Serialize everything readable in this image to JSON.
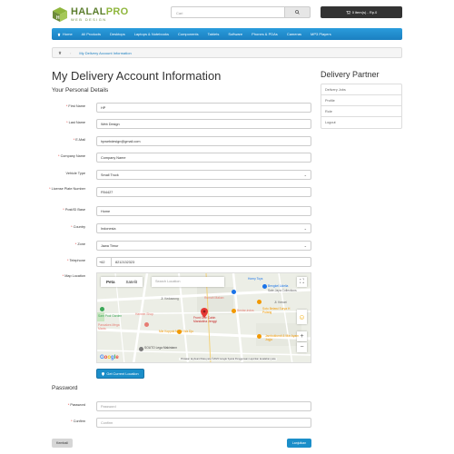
{
  "header": {
    "logo_main": "HALAL",
    "logo_pro": "PRO",
    "logo_sub": "WEB DESIGN",
    "search_placeholder": "Cari",
    "cart_label": "0 item(s) - Rp.0"
  },
  "menu": {
    "items": [
      "Home",
      "All Products",
      "Desktops",
      "Laptops & Notebooks",
      "Components",
      "Tablets",
      "Software",
      "Phones & PDAs",
      "Cameras",
      "MP3 Players"
    ]
  },
  "breadcrumb": {
    "current": "My Delivery Account Information"
  },
  "page": {
    "title": "My Delivery Account Information",
    "personal_heading": "Your Personal Details",
    "password_heading": "Password"
  },
  "form": {
    "first_name": {
      "label": "First Name",
      "value": "HP"
    },
    "last_name": {
      "label": "Last Name",
      "value": "Web Design"
    },
    "email": {
      "label": "E-Mail",
      "value": "hpwebdesign@gmail.com"
    },
    "company": {
      "label": "Company Name",
      "value": "Company Name"
    },
    "vehicle": {
      "label": "Vehicle Type",
      "value": "Small Truck"
    },
    "license": {
      "label": "License Plate Number",
      "value": "FB4427"
    },
    "post_base": {
      "label": "Post/ID Base",
      "value": "Home"
    },
    "country": {
      "label": "Country",
      "value": "Indonesia"
    },
    "zone": {
      "label": "Zone",
      "value": "Jawa Timur"
    },
    "telephone": {
      "label": "Telephone",
      "code": "+62",
      "value": "8212132323"
    },
    "map_location": {
      "label": "Map Location"
    },
    "password": {
      "label": "Password",
      "placeholder": "Password"
    },
    "confirm": {
      "label": "Confirm",
      "placeholder": "Confirm"
    }
  },
  "map": {
    "tab_map": "Peta",
    "tab_sat": "Satelit",
    "search_placeholder": "Search Location",
    "labels": {
      "l1": "Horny Toys",
      "l2": "Bengkel Lidelia",
      "l3": "Sale-Jaya Collections",
      "l4": "Jl. Kedawung",
      "l5": "Rumah Makan",
      "l6": "Bentar-indos",
      "l7": "Sam Pool Garden",
      "l8": "Harwee Shop",
      "l9": "Front One Cabin Mandalina Jenggi",
      "l10": "Soto Betawi Surya H Pulang",
      "l11": "Pancakes Mega Manis",
      "l12": "Mie Kopyok Mbah Wa Djo",
      "l13": "Jambuklundi & Mie Ayam Jogja",
      "l14": "SOUTO Lega Makintann",
      "l15": "Jl. Kenari"
    },
    "google": "Google",
    "footer": "Pintasan keyboard   Data peta ©2023 Google   Syarat Penggunaan   Laporkan kesalahan peta"
  },
  "buttons": {
    "current_location": "Get Current Location",
    "back": "Kembali",
    "continue": "Lanjutkan"
  },
  "sidebar": {
    "title": "Delivery Partner",
    "items": [
      "Delivery Jobs",
      "Profile",
      "Role",
      "Logout"
    ]
  }
}
